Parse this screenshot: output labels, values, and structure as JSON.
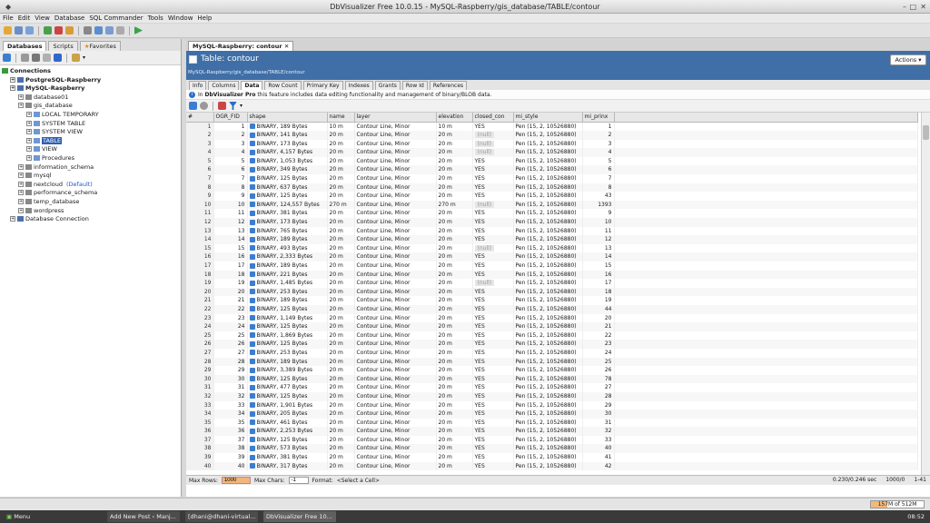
{
  "window": {
    "title": "DbVisualizer Free 10.0.15 - MySQL-Raspberry/gis_database/TABLE/contour"
  },
  "menu": [
    "File",
    "Edit",
    "View",
    "Database",
    "SQL Commander",
    "Tools",
    "Window",
    "Help"
  ],
  "left_tabs": [
    "Databases",
    "Scripts",
    "Favorites"
  ],
  "tree": [
    {
      "label": "Connections",
      "level": 0,
      "bold": true
    },
    {
      "label": "PostgreSQL-Raspberry",
      "level": 1,
      "bold": true
    },
    {
      "label": "MySQL-Raspberry",
      "level": 1,
      "bold": true
    },
    {
      "label": "database01",
      "level": 2
    },
    {
      "label": "gis_database",
      "level": 2
    },
    {
      "label": "LOCAL TEMPORARY",
      "level": 3
    },
    {
      "label": "SYSTEM TABLE",
      "level": 3
    },
    {
      "label": "SYSTEM VIEW",
      "level": 3
    },
    {
      "label": "TABLE",
      "level": 3,
      "selected": true
    },
    {
      "label": "VIEW",
      "level": 3
    },
    {
      "label": "Procedures",
      "level": 3
    },
    {
      "label": "information_schema",
      "level": 2
    },
    {
      "label": "mysql",
      "level": 2
    },
    {
      "label": "nextcloud",
      "level": 2,
      "suffix": "(Default)"
    },
    {
      "label": "performance_schema",
      "level": 2
    },
    {
      "label": "temp_database",
      "level": 2
    },
    {
      "label": "wordpress",
      "level": 2
    },
    {
      "label": "Database Connection",
      "level": 1
    }
  ],
  "editor_tab": "MySQL-Raspberry: contour",
  "object": {
    "title": "Table: contour",
    "path": "MySQL-Raspberry/gis_database/TABLE/contour",
    "actions": "Actions"
  },
  "subtabs": [
    "Info",
    "Columns",
    "Data",
    "Row Count",
    "Primary Key",
    "Indexes",
    "Grants",
    "Row Id",
    "References"
  ],
  "info_bar": {
    "bold": "DbVisualizer Pro",
    "prefix": "In",
    "text": "this feature includes data editing functionality and management of binary/BLOB data."
  },
  "grid": {
    "columns": [
      "#",
      "OGR_FID",
      "shape",
      "name",
      "layer",
      "elevation",
      "closed_con",
      "mi_style",
      "mi_prinx"
    ],
    "rows": [
      [
        1,
        1,
        "BINARY, 189 Bytes",
        "10 m",
        "Contour Line, Minor",
        "10 m",
        "YES",
        "Pen (15, 2, 10526880)",
        1
      ],
      [
        2,
        2,
        "BINARY, 141 Bytes",
        "20 m",
        "Contour Line, Minor",
        "20 m",
        "(null)",
        "Pen (15, 2, 10526880)",
        2
      ],
      [
        3,
        3,
        "BINARY, 173 Bytes",
        "20 m",
        "Contour Line, Minor",
        "20 m",
        "(null)",
        "Pen (15, 2, 10526880)",
        3
      ],
      [
        4,
        4,
        "BINARY, 4,157 Bytes",
        "20 m",
        "Contour Line, Minor",
        "20 m",
        "(null)",
        "Pen (15, 2, 10526880)",
        4
      ],
      [
        5,
        5,
        "BINARY, 1,053 Bytes",
        "20 m",
        "Contour Line, Minor",
        "20 m",
        "YES",
        "Pen (15, 2, 10526880)",
        5
      ],
      [
        6,
        6,
        "BINARY, 349 Bytes",
        "20 m",
        "Contour Line, Minor",
        "20 m",
        "YES",
        "Pen (15, 2, 10526880)",
        6
      ],
      [
        7,
        7,
        "BINARY, 125 Bytes",
        "20 m",
        "Contour Line, Minor",
        "20 m",
        "YES",
        "Pen (15, 2, 10526880)",
        7
      ],
      [
        8,
        8,
        "BINARY, 637 Bytes",
        "20 m",
        "Contour Line, Minor",
        "20 m",
        "YES",
        "Pen (15, 2, 10526880)",
        8
      ],
      [
        9,
        9,
        "BINARY, 125 Bytes",
        "20 m",
        "Contour Line, Minor",
        "20 m",
        "YES",
        "Pen (15, 2, 10526880)",
        43
      ],
      [
        10,
        10,
        "BINARY, 124,557 Bytes",
        "270 m",
        "Contour Line, Minor",
        "270 m",
        "(null)",
        "Pen (15, 2, 10526880)",
        1393
      ],
      [
        11,
        11,
        "BINARY, 381 Bytes",
        "20 m",
        "Contour Line, Minor",
        "20 m",
        "YES",
        "Pen (15, 2, 10526880)",
        9
      ],
      [
        12,
        12,
        "BINARY, 173 Bytes",
        "20 m",
        "Contour Line, Minor",
        "20 m",
        "YES",
        "Pen (15, 2, 10526880)",
        10
      ],
      [
        13,
        13,
        "BINARY, 765 Bytes",
        "20 m",
        "Contour Line, Minor",
        "20 m",
        "YES",
        "Pen (15, 2, 10526880)",
        11
      ],
      [
        14,
        14,
        "BINARY, 189 Bytes",
        "20 m",
        "Contour Line, Minor",
        "20 m",
        "YES",
        "Pen (15, 2, 10526880)",
        12
      ],
      [
        15,
        15,
        "BINARY, 493 Bytes",
        "20 m",
        "Contour Line, Minor",
        "20 m",
        "(null)",
        "Pen (15, 2, 10526880)",
        13
      ],
      [
        16,
        16,
        "BINARY, 2,333 Bytes",
        "20 m",
        "Contour Line, Minor",
        "20 m",
        "YES",
        "Pen (15, 2, 10526880)",
        14
      ],
      [
        17,
        17,
        "BINARY, 189 Bytes",
        "20 m",
        "Contour Line, Minor",
        "20 m",
        "YES",
        "Pen (15, 2, 10526880)",
        15
      ],
      [
        18,
        18,
        "BINARY, 221 Bytes",
        "20 m",
        "Contour Line, Minor",
        "20 m",
        "YES",
        "Pen (15, 2, 10526880)",
        16
      ],
      [
        19,
        19,
        "BINARY, 1,485 Bytes",
        "20 m",
        "Contour Line, Minor",
        "20 m",
        "(null)",
        "Pen (15, 2, 10526880)",
        17
      ],
      [
        20,
        20,
        "BINARY, 253 Bytes",
        "20 m",
        "Contour Line, Minor",
        "20 m",
        "YES",
        "Pen (15, 2, 10526880)",
        18
      ],
      [
        21,
        21,
        "BINARY, 189 Bytes",
        "20 m",
        "Contour Line, Minor",
        "20 m",
        "YES",
        "Pen (15, 2, 10526880)",
        19
      ],
      [
        22,
        22,
        "BINARY, 125 Bytes",
        "20 m",
        "Contour Line, Minor",
        "20 m",
        "YES",
        "Pen (15, 2, 10526880)",
        44
      ],
      [
        23,
        23,
        "BINARY, 1,149 Bytes",
        "20 m",
        "Contour Line, Minor",
        "20 m",
        "YES",
        "Pen (15, 2, 10526880)",
        20
      ],
      [
        24,
        24,
        "BINARY, 125 Bytes",
        "20 m",
        "Contour Line, Minor",
        "20 m",
        "YES",
        "Pen (15, 2, 10526880)",
        21
      ],
      [
        25,
        25,
        "BINARY, 1,869 Bytes",
        "20 m",
        "Contour Line, Minor",
        "20 m",
        "YES",
        "Pen (15, 2, 10526880)",
        22
      ],
      [
        26,
        26,
        "BINARY, 125 Bytes",
        "20 m",
        "Contour Line, Minor",
        "20 m",
        "YES",
        "Pen (15, 2, 10526880)",
        23
      ],
      [
        27,
        27,
        "BINARY, 253 Bytes",
        "20 m",
        "Contour Line, Minor",
        "20 m",
        "YES",
        "Pen (15, 2, 10526880)",
        24
      ],
      [
        28,
        28,
        "BINARY, 189 Bytes",
        "20 m",
        "Contour Line, Minor",
        "20 m",
        "YES",
        "Pen (15, 2, 10526880)",
        25
      ],
      [
        29,
        29,
        "BINARY, 3,389 Bytes",
        "20 m",
        "Contour Line, Minor",
        "20 m",
        "YES",
        "Pen (15, 2, 10526880)",
        26
      ],
      [
        30,
        30,
        "BINARY, 125 Bytes",
        "20 m",
        "Contour Line, Minor",
        "20 m",
        "YES",
        "Pen (15, 2, 10526880)",
        78
      ],
      [
        31,
        31,
        "BINARY, 477 Bytes",
        "20 m",
        "Contour Line, Minor",
        "20 m",
        "YES",
        "Pen (15, 2, 10526880)",
        27
      ],
      [
        32,
        32,
        "BINARY, 125 Bytes",
        "20 m",
        "Contour Line, Minor",
        "20 m",
        "YES",
        "Pen (15, 2, 10526880)",
        28
      ],
      [
        33,
        33,
        "BINARY, 1,901 Bytes",
        "20 m",
        "Contour Line, Minor",
        "20 m",
        "YES",
        "Pen (15, 2, 10526880)",
        29
      ],
      [
        34,
        34,
        "BINARY, 205 Bytes",
        "20 m",
        "Contour Line, Minor",
        "20 m",
        "YES",
        "Pen (15, 2, 10526880)",
        30
      ],
      [
        35,
        35,
        "BINARY, 461 Bytes",
        "20 m",
        "Contour Line, Minor",
        "20 m",
        "YES",
        "Pen (15, 2, 10526880)",
        31
      ],
      [
        36,
        36,
        "BINARY, 2,253 Bytes",
        "20 m",
        "Contour Line, Minor",
        "20 m",
        "YES",
        "Pen (15, 2, 10526880)",
        32
      ],
      [
        37,
        37,
        "BINARY, 125 Bytes",
        "20 m",
        "Contour Line, Minor",
        "20 m",
        "YES",
        "Pen (15, 2, 10526880)",
        33
      ],
      [
        38,
        38,
        "BINARY, 573 Bytes",
        "20 m",
        "Contour Line, Minor",
        "20 m",
        "YES",
        "Pen (15, 2, 10526880)",
        40
      ],
      [
        39,
        39,
        "BINARY, 381 Bytes",
        "20 m",
        "Contour Line, Minor",
        "20 m",
        "YES",
        "Pen (15, 2, 10526880)",
        41
      ],
      [
        40,
        40,
        "BINARY, 317 Bytes",
        "20 m",
        "Contour Line, Minor",
        "20 m",
        "YES",
        "Pen (15, 2, 10526880)",
        42
      ]
    ]
  },
  "status": {
    "max_rows_label": "Max Rows:",
    "max_rows": "1000",
    "max_chars_label": "Max Chars:",
    "max_chars": "-1",
    "format_label": "Format:",
    "format_value": "<Select a Cell>",
    "timing": "0.230/0.246 sec",
    "rows_ratio": "1000/0",
    "range": "1-41"
  },
  "memory": {
    "label": "157M of 512M",
    "fraction": 0.31
  },
  "taskbar": {
    "menu": "Menu",
    "items": [
      "Add New Post ‹ Manj...",
      "[dhani@dhani-virtual...",
      "DbVisualizer Free 10..."
    ],
    "clock": "08:52"
  },
  "colors": {
    "header": "#3f6fa6",
    "selection": "#2f5fb3",
    "accent": "#f2b97a"
  }
}
